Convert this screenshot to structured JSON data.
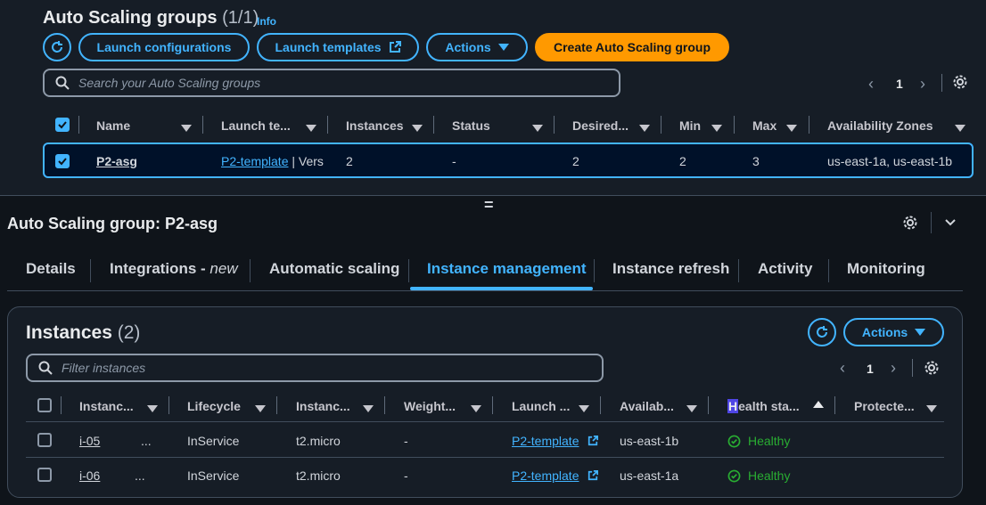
{
  "groups": {
    "title": "Auto Scaling groups",
    "count": "(1/1)",
    "info": "Info",
    "launch_configurations": "Launch configurations",
    "launch_templates": "Launch templates",
    "actions": "Actions",
    "create": "Create Auto Scaling group",
    "search_placeholder": "Search your Auto Scaling groups",
    "page": "1",
    "columns": [
      "Name",
      "Launch te...",
      "Instances",
      "Status",
      "Desired...",
      "Min",
      "Max",
      "Availability Zones"
    ],
    "row": {
      "name": "P2-asg",
      "template": "P2-template",
      "template_suffix": " | Vers",
      "instances": "2",
      "status": "-",
      "desired": "2",
      "min": "2",
      "max": "3",
      "azs": "us-east-1a, us-east-1b"
    }
  },
  "splitter": "=",
  "details": {
    "title": "Auto Scaling group: P2-asg",
    "tabs": {
      "details": "Details",
      "integrations": "Integrations - ",
      "integrations_new": "new",
      "automatic": "Automatic scaling",
      "instance_mgmt": "Instance management",
      "instance_refresh": "Instance refresh",
      "activity": "Activity",
      "monitoring": "Monitoring"
    }
  },
  "instances": {
    "title": "Instances",
    "count": "(2)",
    "actions": "Actions",
    "filter_placeholder": "Filter instances",
    "page": "1",
    "columns": [
      "Instanc...",
      "Lifecycle",
      "Instanc...",
      "Weight...",
      "Launch ...",
      "Availab...",
      "ealth sta...",
      "Protecte..."
    ],
    "health_first_letter": "H",
    "rows": [
      {
        "id": "i-05",
        "ellipsis": "...",
        "lifecycle": "InService",
        "type": "t2.micro",
        "weight": "-",
        "template": "P2-template",
        "az": "us-east-1b",
        "health": "Healthy"
      },
      {
        "id": "i-06",
        "ellipsis": "...",
        "lifecycle": "InService",
        "type": "t2.micro",
        "weight": "-",
        "template": "P2-template",
        "az": "us-east-1a",
        "health": "Healthy"
      }
    ]
  },
  "colors": {
    "accent": "#42b4ff",
    "primary": "#ff9900",
    "success": "#29ad32",
    "bg": "#0f141a"
  }
}
